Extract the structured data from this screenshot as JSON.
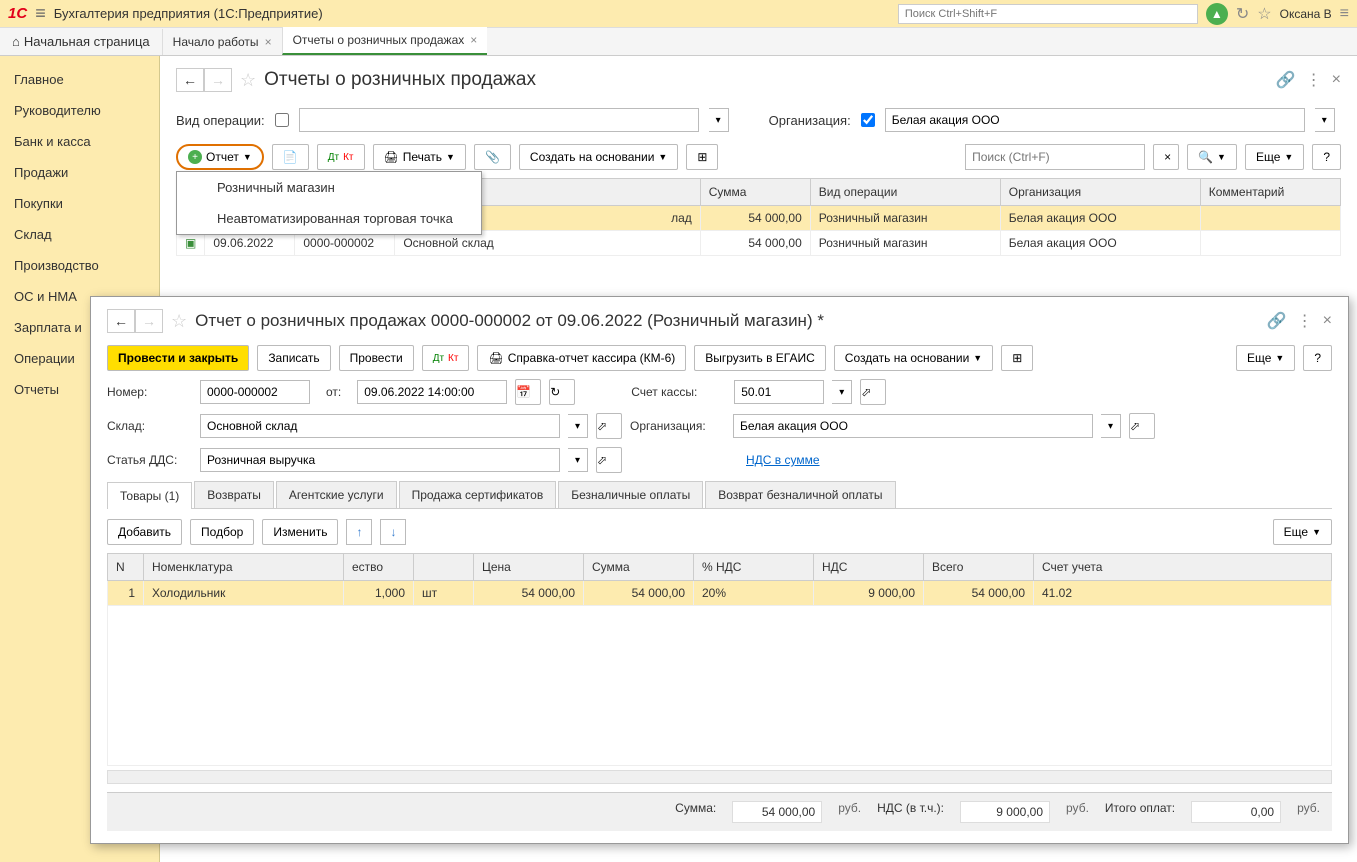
{
  "titlebar": {
    "logo": "1С",
    "app_title": "Бухгалтерия предприятия  (1С:Предприятие)",
    "search_placeholder": "Поиск Ctrl+Shift+F",
    "user": "Оксана В"
  },
  "tabs": {
    "home": "Начальная страница",
    "items": [
      "Начало работы",
      "Отчеты о розничных продажах"
    ]
  },
  "sidebar": {
    "items": [
      "Главное",
      "Руководителю",
      "Банк и касса",
      "Продажи",
      "Покупки",
      "Склад",
      "Производство",
      "ОС и НМА",
      "Зарплата и",
      "Операции",
      "Отчеты"
    ]
  },
  "list_page": {
    "title": "Отчеты о розничных продажах",
    "filters": {
      "operation_label": "Вид операции:",
      "org_label": "Организация:",
      "org_value": "Белая акация ООО"
    },
    "toolbar": {
      "report_btn": "Отчет",
      "print_btn": "Печать",
      "create_based_btn": "Создать на основании",
      "search_placeholder": "Поиск (Ctrl+F)",
      "more_btn": "Еще",
      "help_btn": "?"
    },
    "dropdown": {
      "item1": "Розничный магазин",
      "item2": "Неавтоматизированная торговая точка"
    },
    "columns": [
      "",
      "",
      "",
      "лад",
      "Сумма",
      "Вид операции",
      "Организация",
      "Комментарий"
    ],
    "rows": [
      {
        "date": "",
        "num": "",
        "sklad": "лад",
        "sum": "54 000,00",
        "op": "Розничный магазин",
        "org": "Белая акация ООО",
        "comment": ""
      },
      {
        "date": "09.06.2022",
        "num": "0000-000002",
        "sklad": "Основной склад",
        "sum": "54 000,00",
        "op": "Розничный магазин",
        "org": "Белая акация ООО",
        "comment": ""
      }
    ]
  },
  "doc": {
    "title": "Отчет о розничных продажах 0000-000002 от 09.06.2022 (Розничный магазин) *",
    "toolbar": {
      "post_close": "Провести и закрыть",
      "save": "Записать",
      "post": "Провести",
      "print_km6": "Справка-отчет кассира (КМ-6)",
      "egais": "Выгрузить в ЕГАИС",
      "create_based": "Создать на основании",
      "more": "Еще",
      "help": "?"
    },
    "fields": {
      "number_label": "Номер:",
      "number": "0000-000002",
      "from_label": "от:",
      "date": "09.06.2022 14:00:00",
      "account_label": "Счет кассы:",
      "account": "50.01",
      "sklad_label": "Склад:",
      "sklad": "Основной склад",
      "org_label": "Организация:",
      "org": "Белая акация ООО",
      "dds_label": "Статья ДДС:",
      "dds": "Розничная выручка",
      "nds_link": "НДС в сумме"
    },
    "tabs": [
      "Товары (1)",
      "Возвраты",
      "Агентские услуги",
      "Продажа сертификатов",
      "Безналичные оплаты",
      "Возврат безналичной оплаты"
    ],
    "item_toolbar": {
      "add": "Добавить",
      "select": "Подбор",
      "edit": "Изменить",
      "more": "Еще"
    },
    "item_cols": [
      "N",
      "Номенклатура",
      "ество",
      "",
      "Цена",
      "Сумма",
      "% НДС",
      "НДС",
      "Всего",
      "Счет учета"
    ],
    "item_rows": [
      {
        "n": "1",
        "nom": "Холодильник",
        "qty": "1,000",
        "unit": "шт",
        "price": "54 000,00",
        "sum": "54 000,00",
        "nds_pct": "20%",
        "nds": "9 000,00",
        "total": "54 000,00",
        "acc": "41.02"
      }
    ],
    "footer": {
      "sum_label": "Сумма:",
      "sum": "54 000,00",
      "rub": "руб.",
      "nds_label": "НДС (в т.ч.):",
      "nds": "9 000,00",
      "total_label": "Итого оплат:",
      "total": "0,00"
    }
  }
}
